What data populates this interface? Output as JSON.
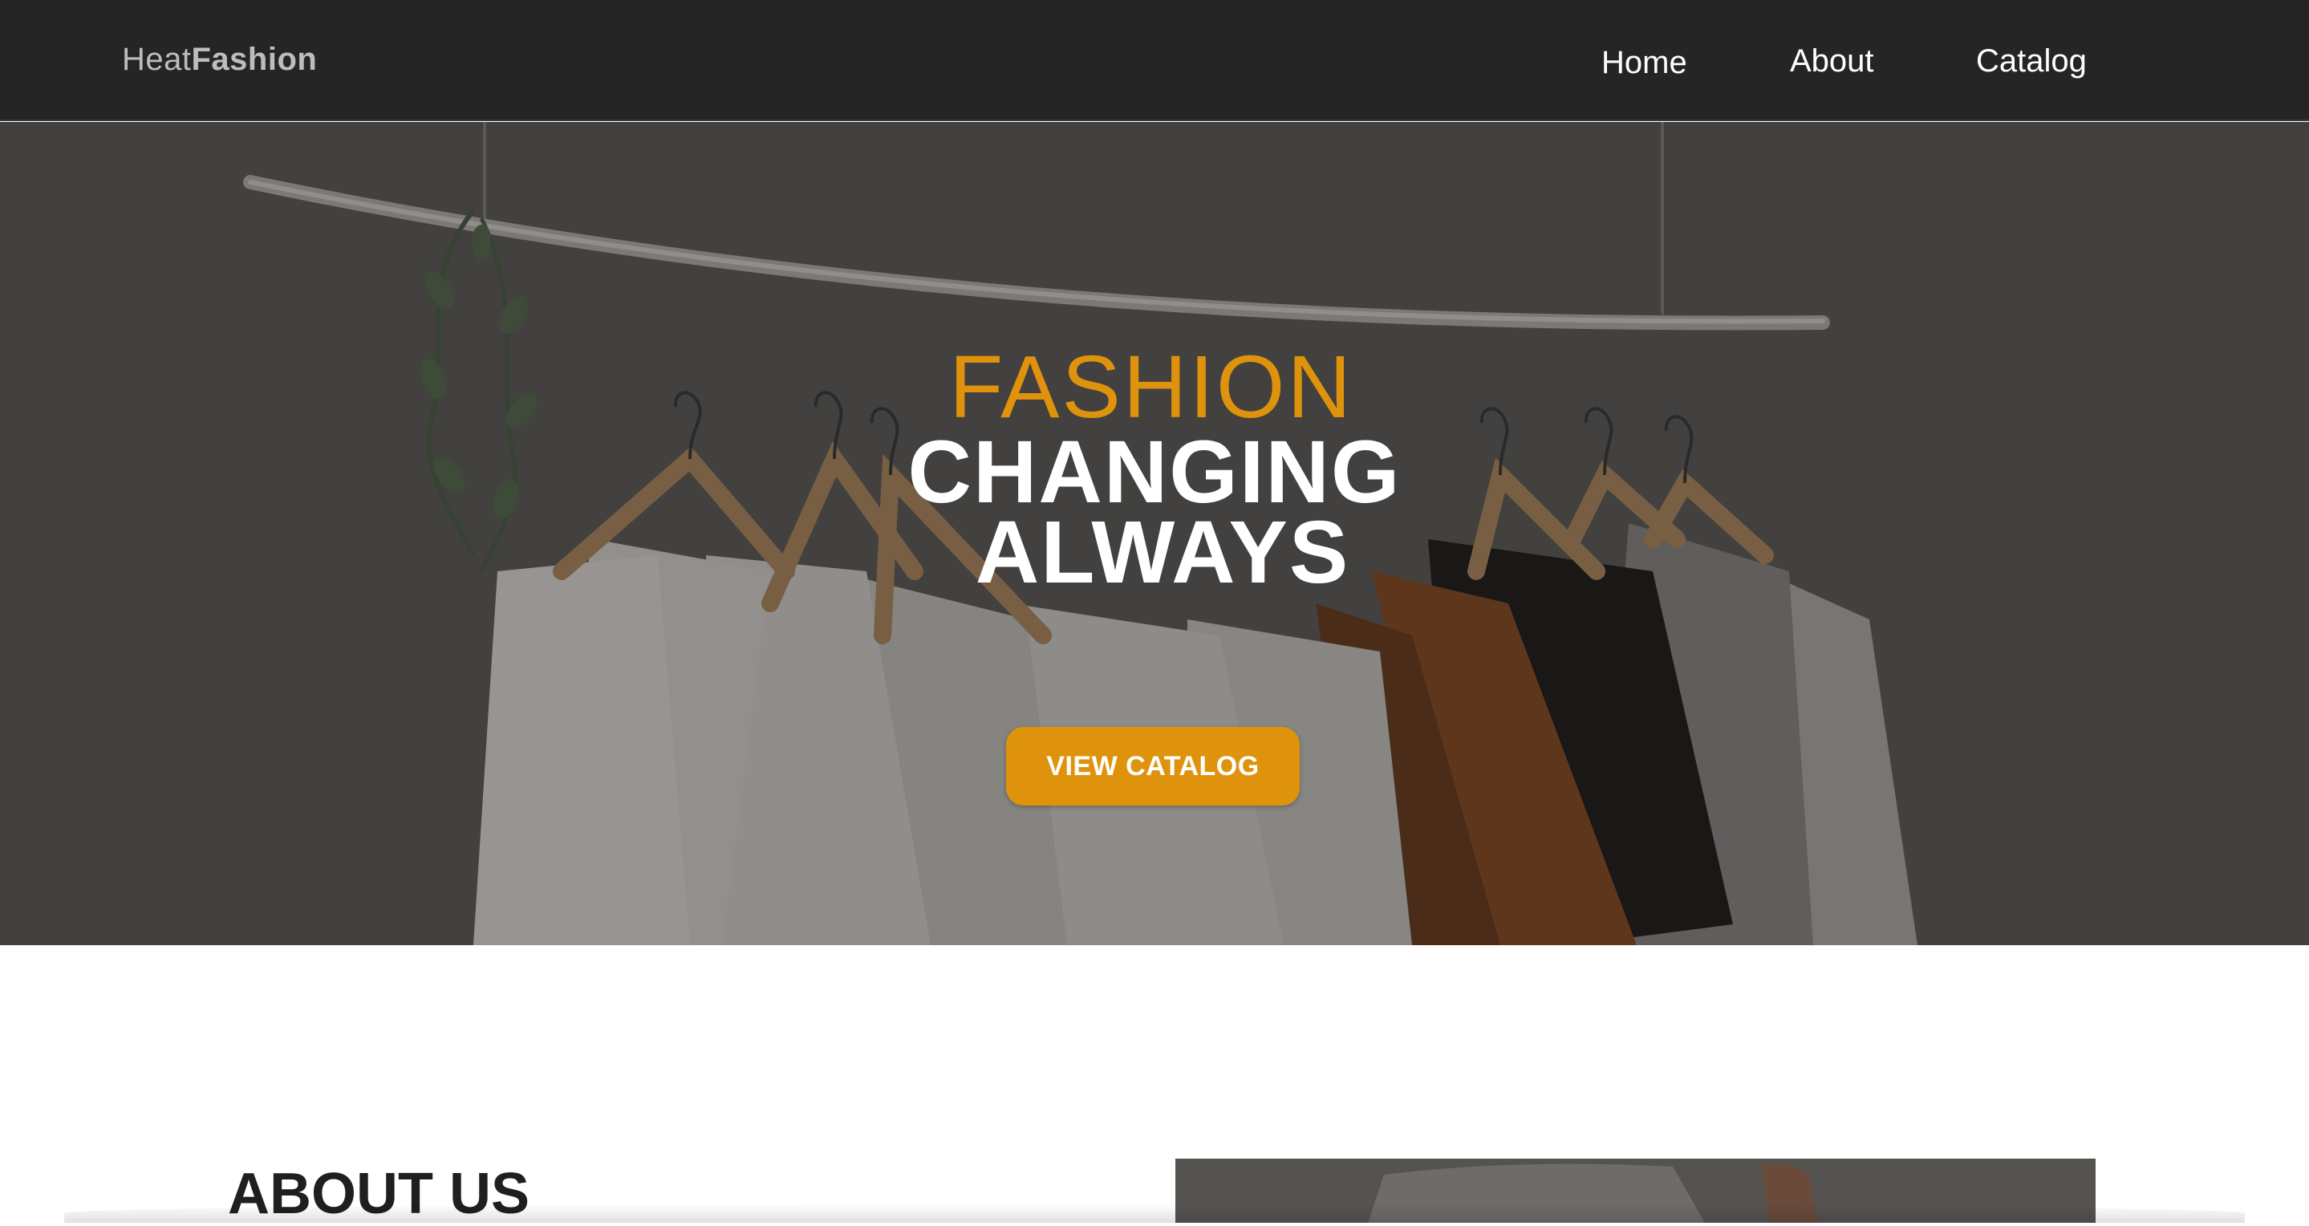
{
  "navbar": {
    "brand_light": "Heat",
    "brand_bold": "Fashion",
    "links": [
      {
        "label": "Home"
      },
      {
        "label": "About"
      },
      {
        "label": "Catalog"
      }
    ]
  },
  "hero": {
    "line1": "FASHION",
    "line2": "CHANGING",
    "line3": "ALWAYS",
    "cta_label": "VIEW CATALOG",
    "background_description_icon": "clothes-rack-photo"
  },
  "about": {
    "title": "ABOUT US"
  },
  "colors": {
    "navbar_bg": "#252525",
    "accent": "#df930c",
    "hero_text": "#ffffff",
    "heading_text": "#1f1f1f"
  }
}
